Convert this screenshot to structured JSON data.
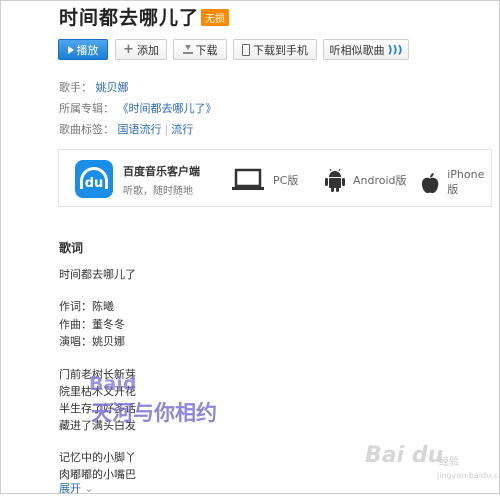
{
  "song": {
    "title": "时间都去哪儿了",
    "badge": "无损"
  },
  "actions": {
    "play": "播放",
    "add": "添加",
    "download": "下载",
    "download_phone": "下载到手机",
    "listen_similar": "听相似歌曲"
  },
  "info": {
    "singer_label": "歌手：",
    "singer": "姚贝娜",
    "album_label": "所属专辑：",
    "album": "《时间都去哪儿了》",
    "tags_label": "歌曲标签：",
    "tags": [
      "国语流行",
      "流行"
    ]
  },
  "promo": {
    "app_title": "百度音乐客户端",
    "app_sub": "听歌，随时随地",
    "platforms": [
      "PC版",
      "Android版",
      "iPhone版"
    ]
  },
  "lyrics": {
    "heading": "歌词",
    "lines": [
      "时间都去哪儿了",
      "作词：陈曦",
      "作曲：董冬冬",
      "演唱：姚贝娜",
      "门前老树长新芽",
      "院里枯木又开花",
      "半生存了好多话",
      "藏进了满头白发",
      "记忆中的小脚丫",
      "肉嘟嘟的小嘴巴"
    ],
    "expand": "展开"
  },
  "watermark": {
    "line1": "Baid",
    "line2": "天河与你相约"
  },
  "corner_logo": {
    "brand": "Bai du",
    "sub": "经验",
    "url": "jingyan.baidu.com"
  },
  "colors": {
    "accent": "#1c7fd6",
    "badge": "#ff8a00",
    "link": "#2a6bb5"
  }
}
